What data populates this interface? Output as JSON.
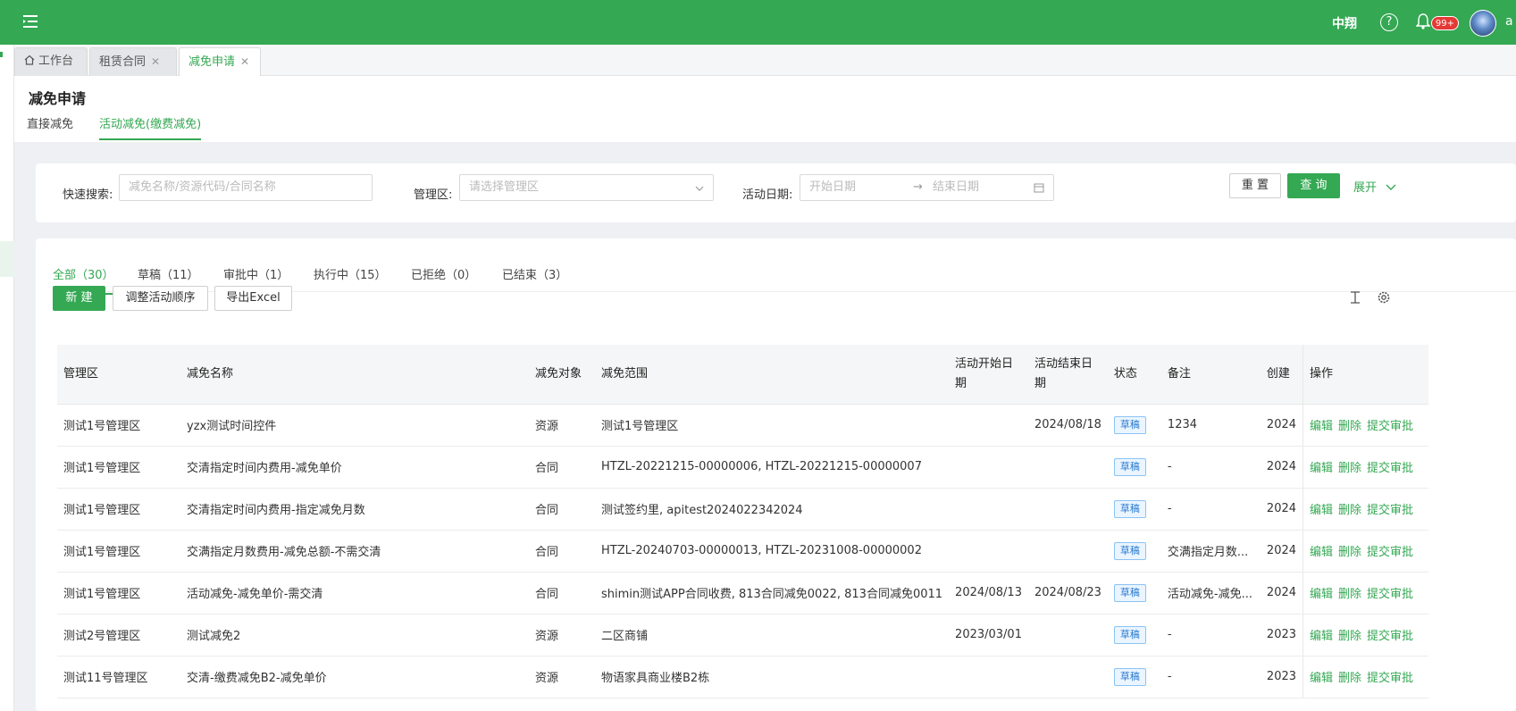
{
  "header": {
    "user_short": "中翔",
    "notification_badge": "99+",
    "user_name": "a"
  },
  "page_tabs": [
    {
      "label": "工作台"
    },
    {
      "label": "租赁合同"
    },
    {
      "label": "减免申请"
    }
  ],
  "page": {
    "title": "减免申请",
    "subtabs": [
      "直接减免",
      "活动减免(缴费减免)"
    ]
  },
  "filter": {
    "quick_search_label": "快速搜索:",
    "quick_search_placeholder": "减免名称/资源代码/合同名称",
    "mgmt_label": "管理区:",
    "mgmt_placeholder": "请选择管理区",
    "date_label": "活动日期:",
    "start_placeholder": "开始日期",
    "end_placeholder": "结束日期",
    "reset": "重 置",
    "query": "查 询",
    "expand": "展开"
  },
  "status_tabs": [
    "全部（30）",
    "草稿（11）",
    "审批中（1）",
    "执行中（15）",
    "已拒绝（0）",
    "已结束（3）"
  ],
  "toolbar": {
    "new": "新 建",
    "adjust": "调整活动顺序",
    "export": "导出Excel"
  },
  "table": {
    "columns": [
      "管理区",
      "减免名称",
      "减免对象",
      "减免范围",
      "活动开始日期",
      "活动结束日期",
      "状态",
      "备注",
      "创建",
      "操作"
    ],
    "rows": [
      [
        "测试1号管理区",
        "yzx测试时间控件",
        "资源",
        "测试1号管理区",
        "",
        "2024/08/18",
        "草稿",
        "1234",
        "2024"
      ],
      [
        "测试1号管理区",
        "交清指定时间内费用-减免单价",
        "合同",
        "HTZL-20221215-00000006, HTZL-20221215-00000007",
        "",
        "",
        "草稿",
        "-",
        "2024"
      ],
      [
        "测试1号管理区",
        "交清指定时间内费用-指定减免月数",
        "合同",
        "测试签约里, apitest2024022342024",
        "",
        "",
        "草稿",
        "-",
        "2024"
      ],
      [
        "测试1号管理区",
        "交满指定月数费用-减免总额-不需交清",
        "合同",
        "HTZL-20240703-00000013, HTZL-20231008-00000002",
        "",
        "",
        "草稿",
        "交满指定月数...",
        "2024"
      ],
      [
        "测试1号管理区",
        "活动减免-减免单价-需交清",
        "合同",
        "shimin测试APP合同收费, 813合同减免0022, 813合同减免0011",
        "2024/08/13",
        "2024/08/23",
        "草稿",
        "活动减免-减免...",
        "2024"
      ],
      [
        "测试2号管理区",
        "测试减免2",
        "资源",
        "二区商铺",
        "2023/03/01",
        "",
        "草稿",
        "-",
        "2023"
      ],
      [
        "测试11号管理区",
        "交清-缴费减免B2-减免单价",
        "资源",
        "物语家具商业楼B2栋",
        "",
        "",
        "草稿",
        "-",
        "2023"
      ]
    ],
    "actions": [
      "编辑",
      "删除",
      "提交审批"
    ]
  },
  "colors": {
    "brand": "#34a853",
    "tag_blue": "#2a7bd0"
  }
}
